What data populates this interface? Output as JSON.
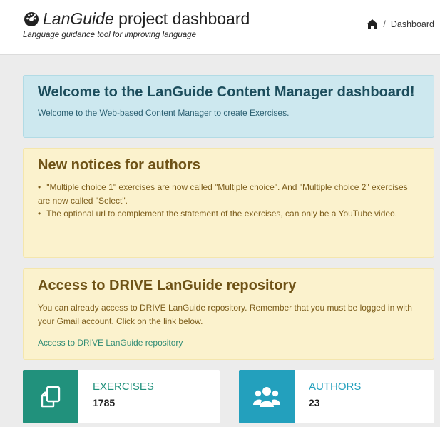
{
  "header": {
    "title_italic": "LanGuide",
    "title_rest": " project dashboard",
    "subtitle": "Language guidance tool for improving language",
    "breadcrumb": {
      "separator": "/",
      "current": "Dashboard"
    }
  },
  "welcome": {
    "heading": "Welcome to the LanGuide Content Manager dashboard!",
    "text": "Welcome to the Web-based Content Manager to create Exercises."
  },
  "notices": {
    "heading": "New notices for authors",
    "items": [
      "\"Multiple choice 1\" exercises are now called \"Multiple choice\". And \"Multiple choice 2\" exercises are now called \"Select\".",
      "The optional url to complement the statement of the exercises, can only be a YouTube video."
    ]
  },
  "drive": {
    "heading": "Access to DRIVE LanGuide repository",
    "text": "You can already access to DRIVE LanGuide repository. Remember that you must be logged in with your Gmail account. Click on the link below.",
    "link": "Access to DRIVE LanGuide repository"
  },
  "stats": {
    "exercises": {
      "label": "EXERCISES",
      "value": "1785",
      "color": "#21917c"
    },
    "authors": {
      "label": "AUTHORS",
      "value": "23",
      "color": "#23a0bd"
    }
  },
  "icons": {
    "title": "dashboard-icon",
    "breadcrumb": "home-icon",
    "exercises": "copy-icon",
    "authors": "users-icon"
  }
}
